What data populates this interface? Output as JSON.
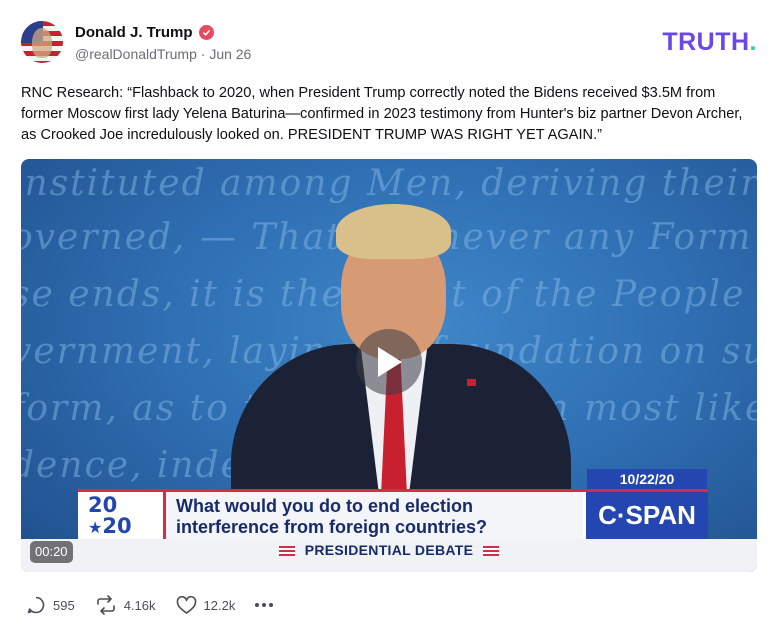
{
  "author": {
    "display_name": "Donald J. Trump",
    "handle": "@realDonaldTrump",
    "date": "Jun 26",
    "verified_icon": "verified-badge-icon"
  },
  "brand": {
    "name": "TRUTH",
    "dot": ".",
    "color": "#6b47e8",
    "accent": "#29d7a9"
  },
  "post": {
    "text": "RNC Research: “Flashback to 2020, when President Trump correctly noted the Bidens received $3.5M from former Moscow first lady Yelena Baturina—confirmed in 2023 testimony from Hunter's biz partner Devon Archer, as Crooked Joe incredulously looked on. PRESIDENT TRUMP WAS RIGHT YET AGAIN.”"
  },
  "video": {
    "duration": "00:20",
    "play_icon": "play-icon",
    "date_tag": "10/22/20",
    "logo_line1": "20",
    "logo_line2": "20",
    "question": "What would you do to end election interference from foreign countries?",
    "network": "C·SPAN",
    "bottom_label": "PRESIDENTIAL DEBATE"
  },
  "actions": {
    "replies": "595",
    "reposts": "4.16k",
    "likes": "12.2k"
  }
}
